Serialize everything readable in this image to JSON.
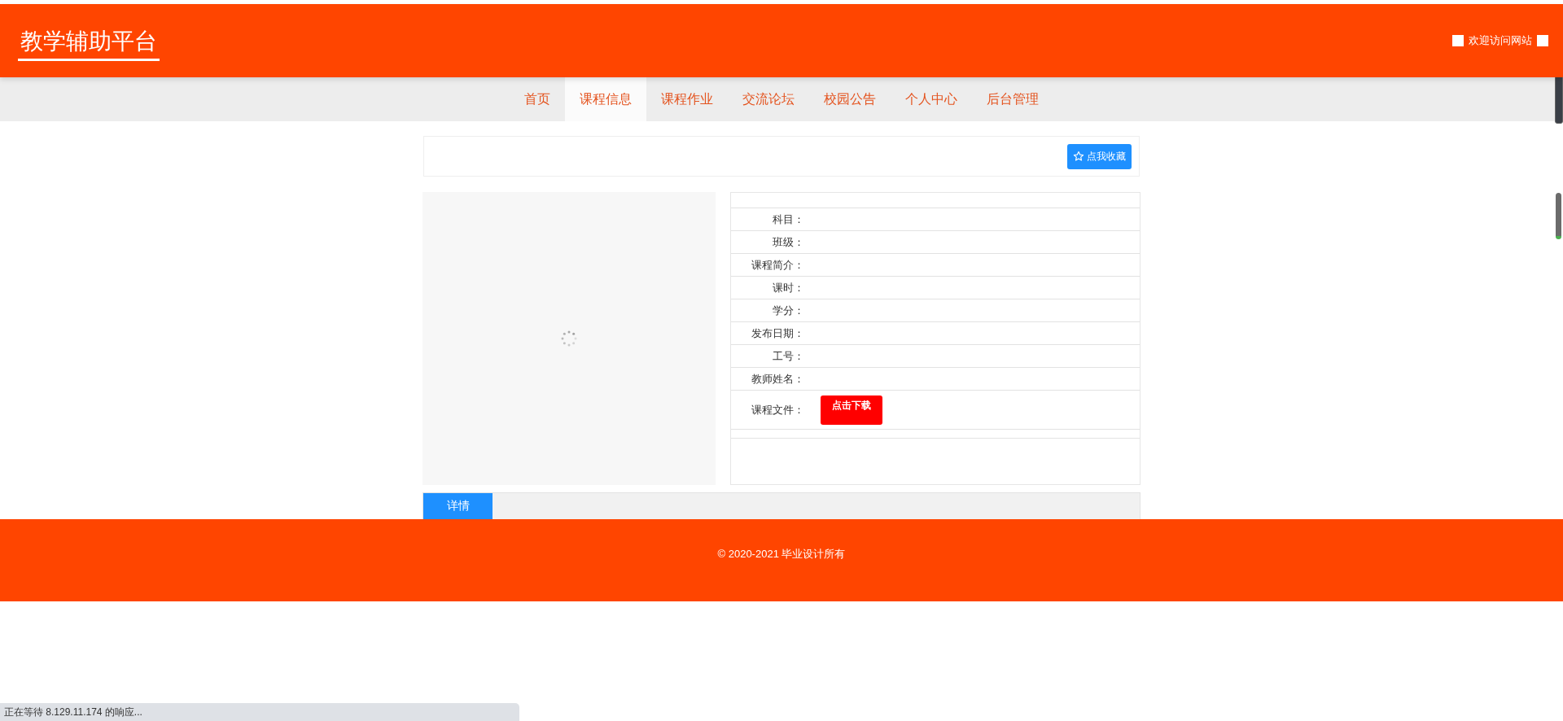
{
  "header": {
    "title": "教学辅助平台",
    "welcome": "欢迎访问网站"
  },
  "nav": [
    {
      "label": "首页",
      "selected": false
    },
    {
      "label": "课程信息",
      "selected": true
    },
    {
      "label": "课程作业",
      "selected": false
    },
    {
      "label": "交流论坛",
      "selected": false
    },
    {
      "label": "校园公告",
      "selected": false
    },
    {
      "label": "个人中心",
      "selected": false
    },
    {
      "label": "后台管理",
      "selected": false
    }
  ],
  "favorite_button": {
    "label": "点我收藏"
  },
  "details": [
    {
      "kind": "text",
      "label": "科目："
    },
    {
      "kind": "text",
      "label": "班级："
    },
    {
      "kind": "text",
      "label": "课程简介："
    },
    {
      "kind": "text",
      "label": "课时："
    },
    {
      "kind": "text",
      "label": "学分："
    },
    {
      "kind": "text",
      "label": "发布日期："
    },
    {
      "kind": "text",
      "label": "工号："
    },
    {
      "kind": "text",
      "label": "教师姓名："
    },
    {
      "kind": "file",
      "label": "课程文件：",
      "button": "点击下载"
    }
  ],
  "tabs": [
    {
      "label": "详情",
      "selected": true
    }
  ],
  "footer": {
    "copyright": "© 2020-2021 毕业设计所有"
  },
  "status_bar": {
    "text": "正在等待 8.129.11.174 的响应..."
  }
}
